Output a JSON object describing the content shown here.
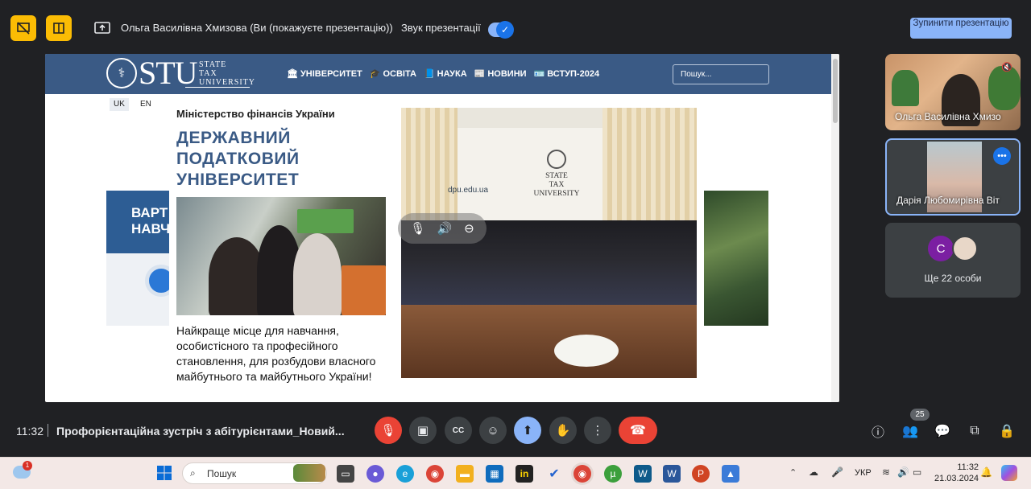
{
  "topbar": {
    "presenter_text": "Ольга Василівна Хмизова (Ви (покажуєте презентацію))",
    "audio_label": "Звук презентації",
    "stop_button": "Зупинити презентацію",
    "accent_color": "#fbbc04"
  },
  "shared_site": {
    "logo_text": "STU",
    "logo_sub": [
      "STATE",
      "TAX",
      "UNIVERSITY"
    ],
    "nav": [
      {
        "icon": "university-icon",
        "label": "УНІВЕРСИТЕТ"
      },
      {
        "icon": "graduation-cap-icon",
        "label": "ОСВІТА"
      },
      {
        "icon": "book-icon",
        "label": "НАУКА"
      },
      {
        "icon": "newspaper-icon",
        "label": "НОВИНИ"
      },
      {
        "icon": "id-card-icon",
        "label": "ВСТУП-2024"
      }
    ],
    "search_placeholder": "Пошук...",
    "lang_uk": "UK",
    "lang_en": "EN",
    "ministry": "Міністерство фінансів України",
    "uni_title": [
      "ДЕРЖАВНИЙ",
      "ПОДАТКОВИЙ",
      "УНІВЕРСИТЕТ"
    ],
    "slogan": "Найкраще місце для навчання, особистісного та професійного становлення, для розбудови власного майбутнього та майбутнього України!",
    "banner_left_text": [
      "ВАРТ",
      "НАВЧ"
    ],
    "photo_logo": [
      "STATE",
      "TAX",
      "UNIVERSITY"
    ],
    "photo_url_text": "dpu.edu.ua",
    "header_color": "#3a5a85"
  },
  "participants": [
    {
      "name": "Ольга Василівна Хмизо"
    },
    {
      "name": "Дарія Любомирівна Віт"
    }
  ],
  "more_tile": {
    "avatar_letter": "С",
    "label": "Ще 22 особи"
  },
  "bottom": {
    "time": "11:32",
    "title": "Профорієнтаційна зустріч з абітурієнтами_Новий...",
    "people_count": "25"
  },
  "taskbar": {
    "search_placeholder": "Пошук",
    "lang": "УКР",
    "time": "11:32",
    "date": "21.03.2024",
    "weather_badge": "1"
  }
}
